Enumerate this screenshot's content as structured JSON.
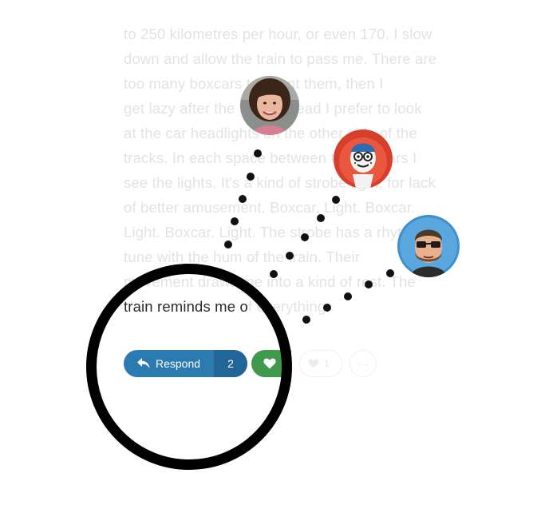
{
  "article": {
    "lines": [
      "to 250 kilometres per hour, or even 170. I slow",
      "down and allow the train to pass me. There are",
      "too many boxcars to count them, then I",
      "get lazy after the fifth. Instead I prefer to look",
      "at the car headlights on the other side of the",
      "tracks. In each space between the boxcars I",
      "see the lights. It's a kind of strobe light, for lack",
      "of better amusement. Boxcar. Light. Boxcar.",
      "Light. Boxcar. Light. The strobe has a rhythm in",
      "tune with the hum of the train. Their",
      "movement draws me into a kind of rest. The"
    ],
    "last_line": {
      "dark": "train reminds me o",
      "light": "f everything."
    }
  },
  "actions": {
    "respond_label": "Respond",
    "respond_count": "2",
    "like_count": "1",
    "more_label": "···"
  },
  "icons": {
    "respond": "reply-arrow-icon",
    "like": "heart-icon",
    "more": "ellipsis-icon"
  },
  "colors": {
    "respond_button": "#2b7bb1",
    "respond_count_bg": "#216696",
    "like_button": "#3f9a4c",
    "focus_ring": "#000000",
    "faded_text": "#e3e3e3"
  }
}
